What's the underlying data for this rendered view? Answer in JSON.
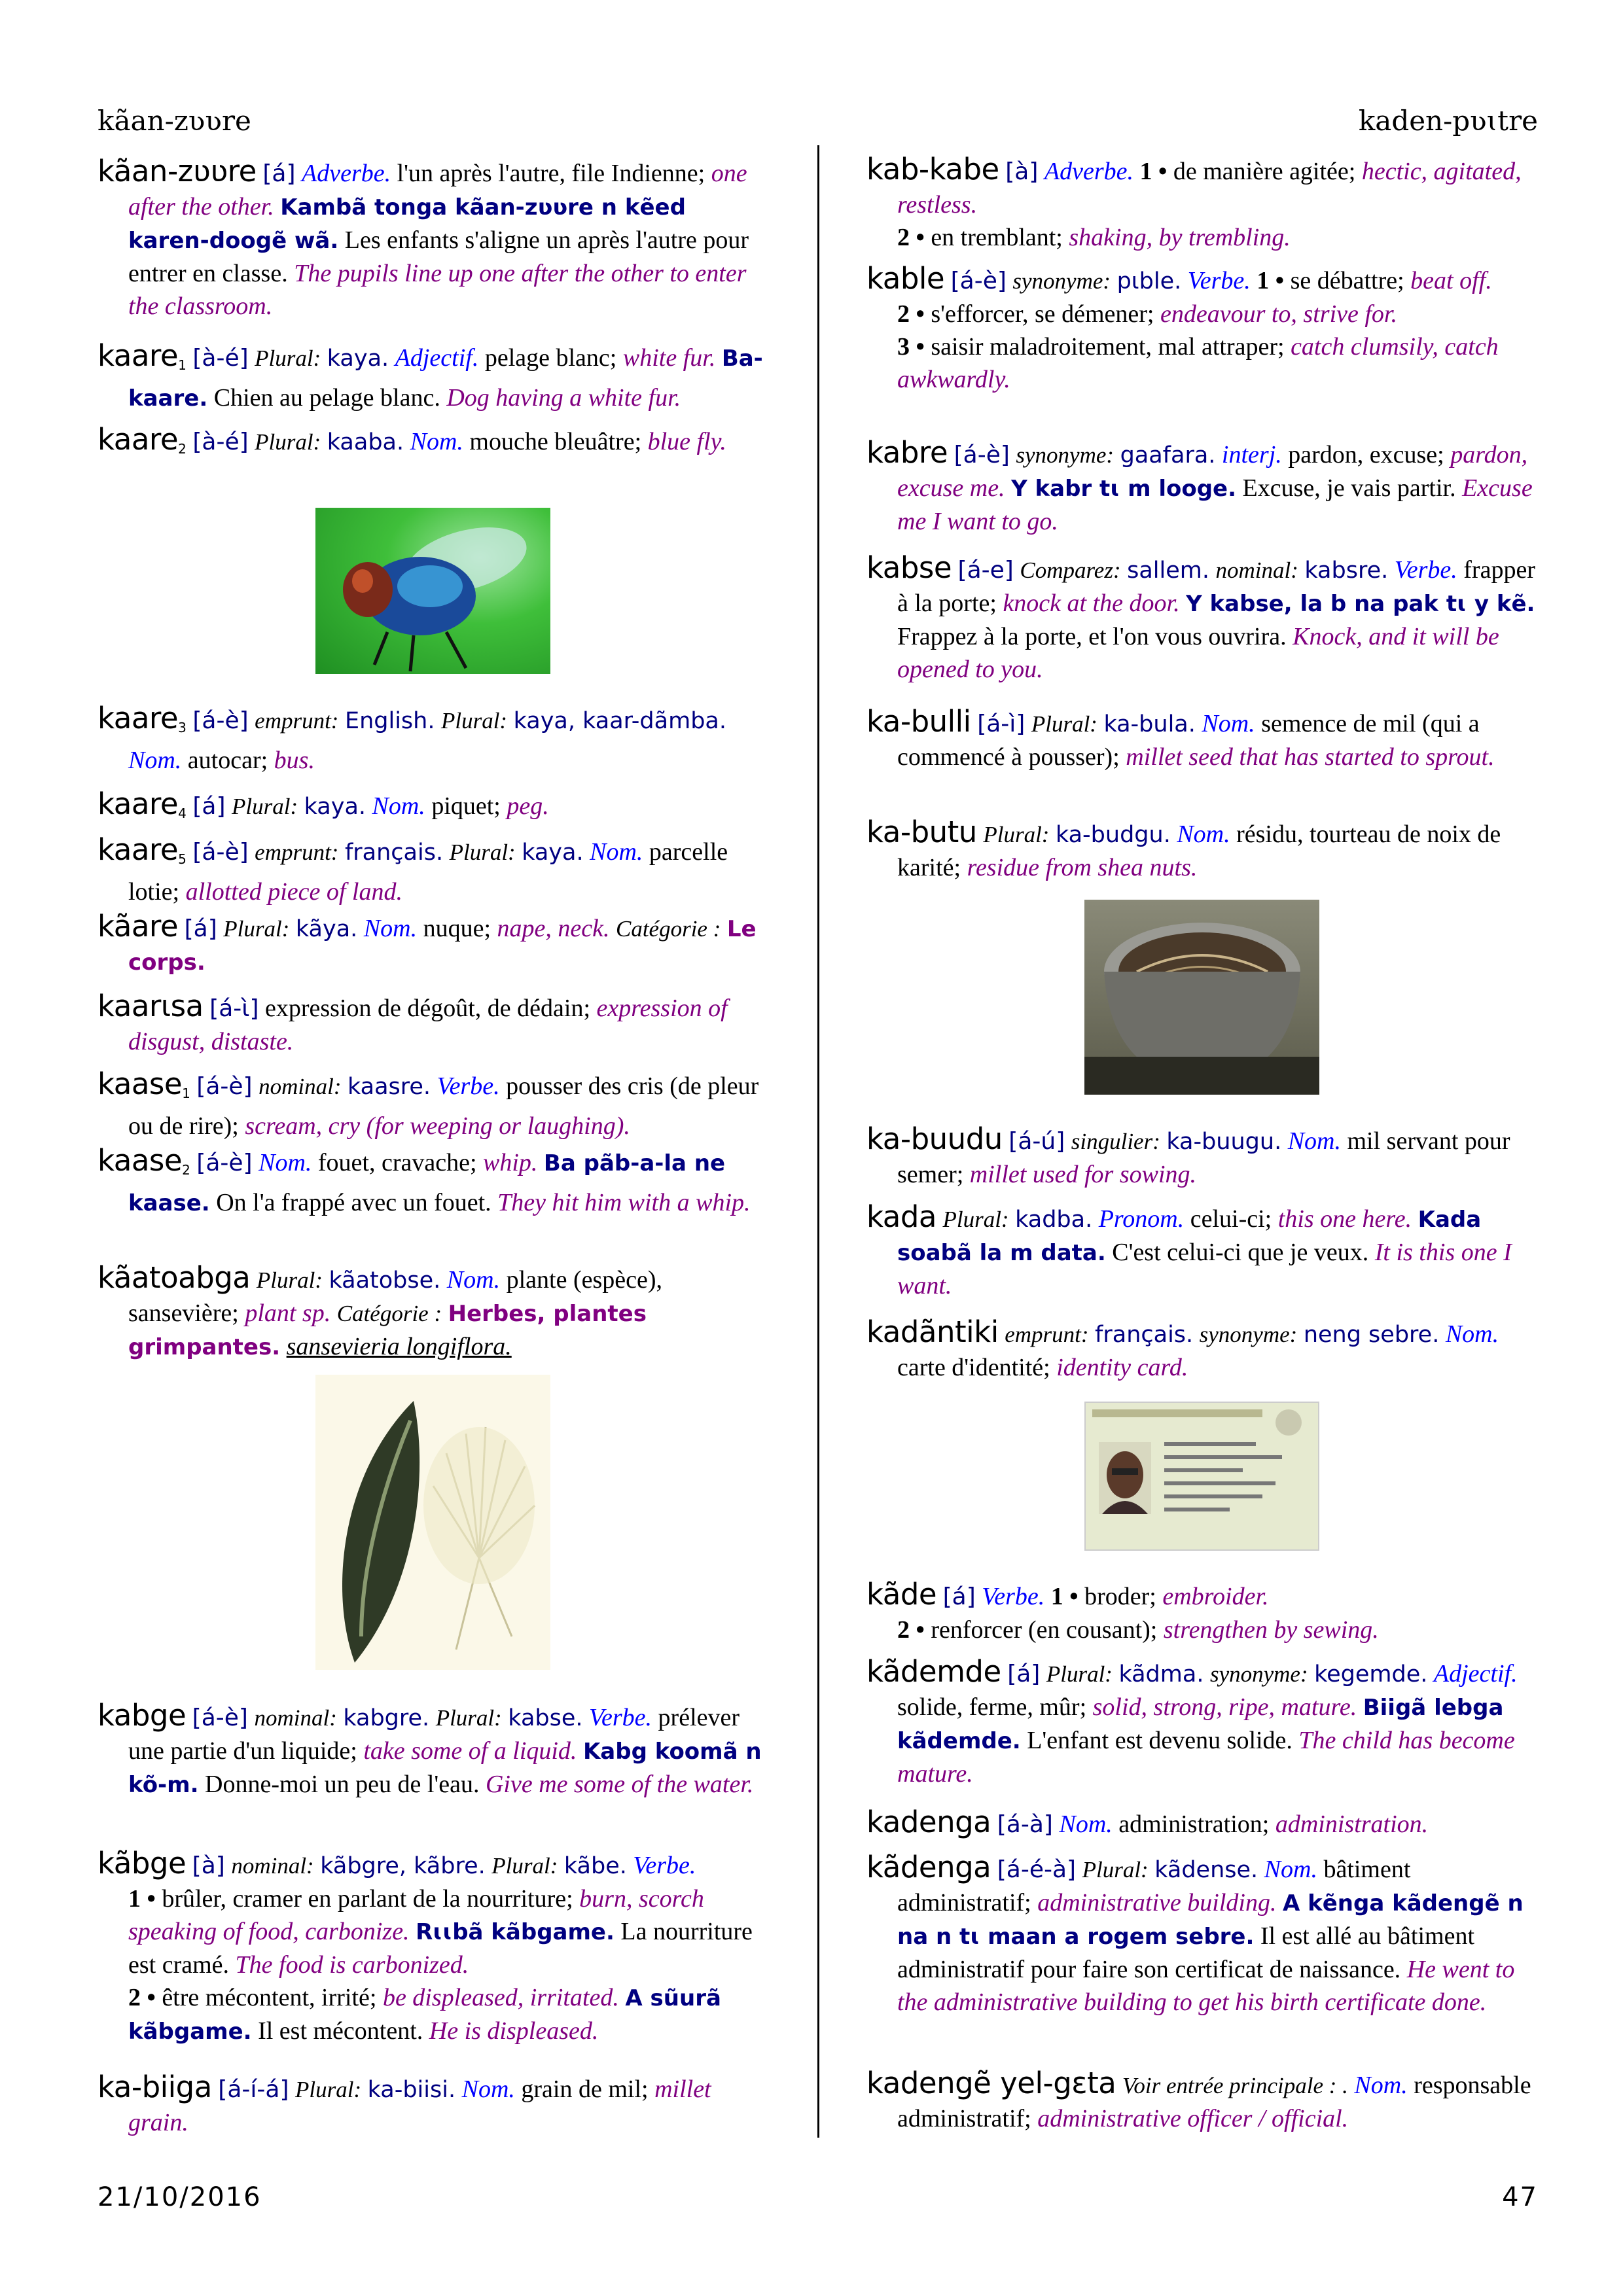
{
  "header": {
    "left": "kãan-zʋʋre",
    "right": "kaden-pʋɩtre"
  },
  "footer": {
    "date": "21/10/2016",
    "page": "47"
  },
  "colors": {
    "vernacular": "#000080",
    "part_of_speech": "#0000ff",
    "gloss": "#800080",
    "text": "#000000"
  },
  "images": {
    "fly": "blue-fly-photo",
    "plant": "sansevieria-plant-illustration",
    "pot": "shea-residue-pot-photo",
    "idcard": "identity-card-photo"
  },
  "left_entries": [
    {
      "segs": [
        [
          "hw",
          "kãan-zʋʋre"
        ],
        [
          "tone",
          "[á]"
        ],
        [
          "pos",
          "Adverbe."
        ],
        [
          "def",
          "l'un après l'autre, file Indienne;"
        ],
        [
          "gloss",
          "one after the other."
        ],
        [
          "ex",
          "Kambã tonga kãan-zʋʋre n kẽed karen-doogẽ wã."
        ],
        [
          "tr",
          "Les enfants s'aligne un après l'autre pour entrer en classe."
        ],
        [
          "extr",
          "The pupils line up one after the other to enter the classroom."
        ]
      ]
    },
    {
      "segs": [
        [
          "hw",
          "kaare"
        ],
        [
          "sub",
          "1"
        ],
        [
          "tone",
          "[à-é]"
        ],
        [
          "lbl",
          "Plural:"
        ],
        [
          "vern",
          "kaya."
        ],
        [
          "pos",
          "Adjectif."
        ],
        [
          "def",
          "pelage blanc;"
        ],
        [
          "gloss",
          "white fur."
        ],
        [
          "ex",
          "Ba-kaare."
        ],
        [
          "tr",
          "Chien au pelage blanc."
        ],
        [
          "extr",
          "Dog having a white fur."
        ]
      ]
    },
    {
      "segs": [
        [
          "hw",
          "kaare"
        ],
        [
          "sub",
          "2"
        ],
        [
          "tone",
          "[à-é]"
        ],
        [
          "lbl",
          "Plural:"
        ],
        [
          "vern",
          "kaaba."
        ],
        [
          "pos",
          "Nom."
        ],
        [
          "def",
          "mouche bleuâtre;"
        ],
        [
          "gloss",
          "blue fly."
        ]
      ]
    },
    {
      "segs": [
        [
          "hw",
          "kaare"
        ],
        [
          "sub",
          "3"
        ],
        [
          "tone",
          "[á-è]"
        ],
        [
          "lbl",
          "emprunt:"
        ],
        [
          "vern",
          "English."
        ],
        [
          "lbl",
          "Plural:"
        ],
        [
          "vern",
          "kaya, kaar-dãmba."
        ],
        [
          "pos",
          "Nom."
        ],
        [
          "def",
          "autocar;"
        ],
        [
          "gloss",
          "bus."
        ]
      ]
    },
    {
      "segs": [
        [
          "hw",
          "kaare"
        ],
        [
          "sub",
          "4"
        ],
        [
          "tone",
          "[á]"
        ],
        [
          "lbl",
          "Plural:"
        ],
        [
          "vern",
          "kaya."
        ],
        [
          "pos",
          "Nom."
        ],
        [
          "def",
          "piquet;"
        ],
        [
          "gloss",
          "peg."
        ]
      ]
    },
    {
      "segs": [
        [
          "hw",
          "kaare"
        ],
        [
          "sub",
          "5"
        ],
        [
          "tone",
          "[á-è]"
        ],
        [
          "lbl",
          "emprunt:"
        ],
        [
          "vern",
          "français."
        ],
        [
          "lbl",
          "Plural:"
        ],
        [
          "vern",
          "kaya."
        ],
        [
          "pos",
          "Nom."
        ],
        [
          "def",
          "parcelle lotie;"
        ],
        [
          "gloss",
          "allotted piece of land."
        ]
      ]
    },
    {
      "segs": [
        [
          "hw",
          "kãare"
        ],
        [
          "tone",
          "[á]"
        ],
        [
          "lbl",
          "Plural:"
        ],
        [
          "vern",
          "kãya."
        ],
        [
          "pos",
          "Nom."
        ],
        [
          "def",
          "nuque;"
        ],
        [
          "gloss",
          "nape, neck."
        ],
        [
          "lbl",
          "Catégorie :"
        ],
        [
          "cat",
          "Le corps."
        ]
      ]
    },
    {
      "segs": [
        [
          "hw",
          "kaarɩsa"
        ],
        [
          "tone",
          "[á-ɩ̀]"
        ],
        [
          "def",
          "expression de dégoût, de dédain;"
        ],
        [
          "gloss",
          "expression of disgust, distaste."
        ]
      ]
    },
    {
      "segs": [
        [
          "hw",
          "kaase"
        ],
        [
          "sub",
          "1"
        ],
        [
          "tone",
          "[á-è]"
        ],
        [
          "lbl",
          "nominal:"
        ],
        [
          "vern",
          "kaasre."
        ],
        [
          "pos",
          "Verbe."
        ],
        [
          "def",
          "pousser des cris (de pleur ou de rire);"
        ],
        [
          "gloss",
          "scream, cry (for weeping or laughing)."
        ]
      ]
    },
    {
      "segs": [
        [
          "hw",
          "kaase"
        ],
        [
          "sub",
          "2"
        ],
        [
          "tone",
          "[á-è]"
        ],
        [
          "pos",
          "Nom."
        ],
        [
          "def",
          "fouet, cravache;"
        ],
        [
          "gloss",
          "whip."
        ],
        [
          "ex",
          "Ba pãb-a-la ne kaase."
        ],
        [
          "tr",
          "On l'a frappé avec un fouet."
        ],
        [
          "extr",
          "They hit him with a whip."
        ]
      ]
    },
    {
      "segs": [
        [
          "hw",
          "kãatoabga"
        ],
        [
          "lbl",
          "Plural:"
        ],
        [
          "vern",
          "kãatobse."
        ],
        [
          "pos",
          "Nom."
        ],
        [
          "def",
          "plante (espèce), sansevière;"
        ],
        [
          "gloss",
          "plant sp."
        ],
        [
          "lbl",
          "Catégorie :"
        ],
        [
          "cat",
          "Herbes, plantes grimpantes."
        ],
        [
          "sci",
          "sansevieria longiflora."
        ]
      ]
    },
    {
      "segs": [
        [
          "hw",
          "kabge"
        ],
        [
          "tone",
          "[á-è]"
        ],
        [
          "lbl",
          "nominal:"
        ],
        [
          "vern",
          "kabgre."
        ],
        [
          "lbl",
          "Plural:"
        ],
        [
          "vern",
          "kabse."
        ],
        [
          "pos",
          "Verbe."
        ],
        [
          "def",
          "prélever une partie d'un liquide;"
        ],
        [
          "gloss",
          "take some of a liquid."
        ],
        [
          "ex",
          "Kabg koomã n kõ-m."
        ],
        [
          "tr",
          "Donne-moi un peu de l'eau."
        ],
        [
          "extr",
          "Give me some of the water."
        ]
      ]
    },
    {
      "segs": [
        [
          "hw",
          "kãbge"
        ],
        [
          "tone",
          "[à]"
        ],
        [
          "lbl",
          "nominal:"
        ],
        [
          "vern",
          "kãbgre, kãbre."
        ],
        [
          "lbl",
          "Plural:"
        ],
        [
          "vern",
          "kãbe."
        ],
        [
          "pos",
          "Verbe."
        ],
        [
          "br",
          ""
        ],
        [
          "num",
          "1 •"
        ],
        [
          "def",
          "brûler, cramer en parlant de la nourriture;"
        ],
        [
          "gloss",
          "burn, scorch speaking of food, carbonize."
        ],
        [
          "ex",
          "Rɩɩbã kãbgame."
        ],
        [
          "tr",
          "La nourriture est cramé."
        ],
        [
          "extr",
          "The food is carbonized."
        ],
        [
          "br",
          ""
        ],
        [
          "num",
          "2 •"
        ],
        [
          "def",
          "être mécontent, irrité;"
        ],
        [
          "gloss",
          "be displeased, irritated."
        ],
        [
          "ex",
          "A sũurã kãbgame."
        ],
        [
          "tr",
          "Il est mécontent."
        ],
        [
          "extr",
          "He is displeased."
        ]
      ]
    },
    {
      "segs": [
        [
          "hw",
          "ka-biiga"
        ],
        [
          "tone",
          "[á-í-á]"
        ],
        [
          "lbl",
          "Plural:"
        ],
        [
          "vern",
          "ka-biisi."
        ],
        [
          "pos",
          "Nom."
        ],
        [
          "def",
          "grain de mil;"
        ],
        [
          "gloss",
          "millet grain."
        ]
      ]
    }
  ],
  "right_entries": [
    {
      "segs": [
        [
          "hw",
          "kab-kabe"
        ],
        [
          "tone",
          "[à]"
        ],
        [
          "pos",
          "Adverbe."
        ],
        [
          "num",
          "1 •"
        ],
        [
          "def",
          "de manière agitée;"
        ],
        [
          "gloss",
          "hectic, agitated, restless."
        ],
        [
          "br",
          ""
        ],
        [
          "num",
          "2 •"
        ],
        [
          "def",
          "en tremblant;"
        ],
        [
          "gloss",
          "shaking, by trembling."
        ]
      ]
    },
    {
      "segs": [
        [
          "hw",
          "kable"
        ],
        [
          "tone",
          "[á-è]"
        ],
        [
          "lbl",
          "synonyme:"
        ],
        [
          "vern",
          "pɩble."
        ],
        [
          "pos",
          "Verbe."
        ],
        [
          "num",
          "1 •"
        ],
        [
          "def",
          "se débattre;"
        ],
        [
          "gloss",
          "beat off."
        ],
        [
          "br",
          ""
        ],
        [
          "num",
          "2 •"
        ],
        [
          "def",
          "s'efforcer, se démener;"
        ],
        [
          "gloss",
          "endeavour to, strive for."
        ],
        [
          "br",
          ""
        ],
        [
          "num",
          "3 •"
        ],
        [
          "def",
          "saisir maladroitement, mal attraper;"
        ],
        [
          "gloss",
          "catch clumsily, catch awkwardly."
        ]
      ]
    },
    {
      "segs": [
        [
          "hw",
          "kabre"
        ],
        [
          "tone",
          "[á-è]"
        ],
        [
          "lbl",
          "synonyme:"
        ],
        [
          "vern",
          "gaafara."
        ],
        [
          "pos",
          "interj."
        ],
        [
          "def",
          "pardon, excuse;"
        ],
        [
          "gloss",
          "pardon, excuse me."
        ],
        [
          "ex",
          "Y kabr tɩ m looge."
        ],
        [
          "tr",
          "Excuse, je vais partir."
        ],
        [
          "extr",
          "Excuse me I want to go."
        ]
      ]
    },
    {
      "segs": [
        [
          "hw",
          "kabse"
        ],
        [
          "tone",
          "[á-e]"
        ],
        [
          "lbl",
          "Comparez:"
        ],
        [
          "vern",
          "sallem."
        ],
        [
          "lbl",
          "nominal:"
        ],
        [
          "vern",
          "kabsre."
        ],
        [
          "pos",
          "Verbe."
        ],
        [
          "def",
          "frapper à la porte;"
        ],
        [
          "gloss",
          "knock at the door."
        ],
        [
          "ex",
          "Y kabse, la b na pak tɩ y kẽ."
        ],
        [
          "tr",
          "Frappez à la porte, et l'on vous ouvrira."
        ],
        [
          "extr",
          "Knock, and it will be opened to you."
        ]
      ]
    },
    {
      "segs": [
        [
          "hw",
          "ka-bulli"
        ],
        [
          "tone",
          "[á-ì]"
        ],
        [
          "lbl",
          "Plural:"
        ],
        [
          "vern",
          "ka-bula."
        ],
        [
          "pos",
          "Nom."
        ],
        [
          "def",
          "semence de mil (qui a commencé à pousser);"
        ],
        [
          "gloss",
          "millet seed that has started to sprout."
        ]
      ]
    },
    {
      "segs": [
        [
          "hw",
          "ka-butu"
        ],
        [
          "lbl",
          "Plural:"
        ],
        [
          "vern",
          "ka-budgu."
        ],
        [
          "pos",
          "Nom."
        ],
        [
          "def",
          "résidu, tourteau de noix de karité;"
        ],
        [
          "gloss",
          "residue from shea nuts."
        ]
      ]
    },
    {
      "segs": [
        [
          "hw",
          "ka-buudu"
        ],
        [
          "tone",
          "[á-ú]"
        ],
        [
          "lbl",
          "singulier:"
        ],
        [
          "vern",
          "ka-buugu."
        ],
        [
          "pos",
          "Nom."
        ],
        [
          "def",
          "mil servant pour semer;"
        ],
        [
          "gloss",
          "millet used for sowing."
        ]
      ]
    },
    {
      "segs": [
        [
          "hw",
          "kada"
        ],
        [
          "lbl",
          "Plural:"
        ],
        [
          "vern",
          "kadba."
        ],
        [
          "pos",
          "Pronom."
        ],
        [
          "def",
          "celui-ci;"
        ],
        [
          "gloss",
          "this one here."
        ],
        [
          "ex",
          "Kada soabã la m data."
        ],
        [
          "tr",
          "C'est celui-ci que je veux."
        ],
        [
          "extr",
          "It is this one I want."
        ]
      ]
    },
    {
      "segs": [
        [
          "hw",
          "kadãntiki"
        ],
        [
          "lbl",
          "emprunt:"
        ],
        [
          "vern",
          "français."
        ],
        [
          "lbl",
          "synonyme:"
        ],
        [
          "vern",
          "neng sebre."
        ],
        [
          "pos",
          "Nom."
        ],
        [
          "def",
          "carte d'identité;"
        ],
        [
          "gloss",
          "identity card."
        ]
      ]
    },
    {
      "segs": [
        [
          "hw",
          "kãde"
        ],
        [
          "tone",
          "[á]"
        ],
        [
          "pos",
          "Verbe."
        ],
        [
          "num",
          "1 •"
        ],
        [
          "def",
          "broder;"
        ],
        [
          "gloss",
          "embroider."
        ],
        [
          "br",
          ""
        ],
        [
          "num",
          "2 •"
        ],
        [
          "def",
          "renforcer (en cousant);"
        ],
        [
          "gloss",
          "strengthen by sewing."
        ]
      ]
    },
    {
      "segs": [
        [
          "hw",
          "kãdemde"
        ],
        [
          "tone",
          "[á]"
        ],
        [
          "lbl",
          "Plural:"
        ],
        [
          "vern",
          "kãdma."
        ],
        [
          "lbl",
          "synonyme:"
        ],
        [
          "vern",
          "kegemde."
        ],
        [
          "pos",
          "Adjectif."
        ],
        [
          "def",
          "solide, ferme, mûr;"
        ],
        [
          "gloss",
          "solid, strong, ripe, mature."
        ],
        [
          "ex",
          "Biigã lebga kãdemde."
        ],
        [
          "tr",
          "L'enfant est devenu solide."
        ],
        [
          "extr",
          "The child has become mature."
        ]
      ]
    },
    {
      "segs": [
        [
          "hw",
          "kadenga"
        ],
        [
          "tone",
          "[á-à]"
        ],
        [
          "pos",
          "Nom."
        ],
        [
          "def",
          "administration;"
        ],
        [
          "gloss",
          "administration."
        ]
      ]
    },
    {
      "segs": [
        [
          "hw",
          "kãdenga"
        ],
        [
          "tone",
          "[á-é-à]"
        ],
        [
          "lbl",
          "Plural:"
        ],
        [
          "vern",
          "kãdense."
        ],
        [
          "pos",
          "Nom."
        ],
        [
          "def",
          "bâtiment administratif;"
        ],
        [
          "gloss",
          "administrative building."
        ],
        [
          "ex",
          "A kẽnga kãdengẽ n na n tɩ maan a rogem sebre."
        ],
        [
          "tr",
          "Il est allé au bâtiment administratif pour faire son certificat de naissance."
        ],
        [
          "extr",
          "He went to the administrative building to get his birth certificate done."
        ]
      ]
    },
    {
      "segs": [
        [
          "hw",
          "kadengẽ yel-gɛta"
        ],
        [
          "lbl",
          "Voir entrée principale : ."
        ],
        [
          "pos",
          "Nom."
        ],
        [
          "def",
          "responsable administratif;"
        ],
        [
          "gloss",
          "administrative officer / official."
        ]
      ]
    }
  ]
}
